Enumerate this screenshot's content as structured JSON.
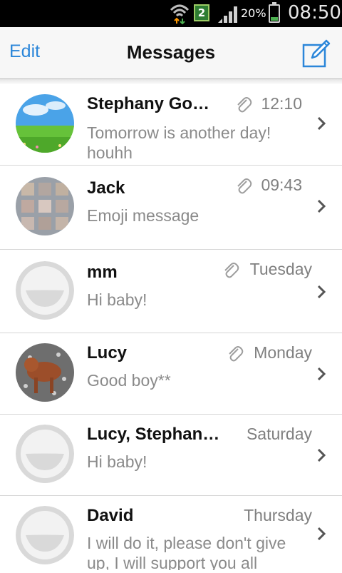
{
  "status_bar": {
    "time": "08:50",
    "battery_percent": "20%",
    "sim_number": "2",
    "icons": [
      "wifi-icon",
      "sim-icon",
      "signal-icon",
      "battery-icon"
    ],
    "battery_level": 0.2
  },
  "header": {
    "edit_label": "Edit",
    "title": "Messages",
    "compose_icon": "compose-icon",
    "accent_color": "#2b86d9"
  },
  "conversations": [
    {
      "name": "Stephany Go…",
      "time": "12:10",
      "has_attachment": true,
      "preview": "Tomorrow is another day! houhh",
      "avatar": "landscape-photo"
    },
    {
      "name": "Jack",
      "time": "09:43",
      "has_attachment": true,
      "preview": "Emoji message",
      "avatar": "photo"
    },
    {
      "name": "mm",
      "time": "Tuesday",
      "has_attachment": true,
      "preview": "Hi baby!",
      "avatar": "default-avatar"
    },
    {
      "name": "Lucy",
      "time": "Monday",
      "has_attachment": true,
      "preview": "Good boy**",
      "avatar": "dog-photo"
    },
    {
      "name": "Lucy, Stephan…",
      "time": "Saturday",
      "has_attachment": false,
      "preview": "Hi baby!",
      "avatar": "default-avatar"
    },
    {
      "name": "David",
      "time": "Thursday",
      "has_attachment": false,
      "preview": "I will do it, please don't give up, I will support you all",
      "avatar": "default-avatar"
    }
  ]
}
